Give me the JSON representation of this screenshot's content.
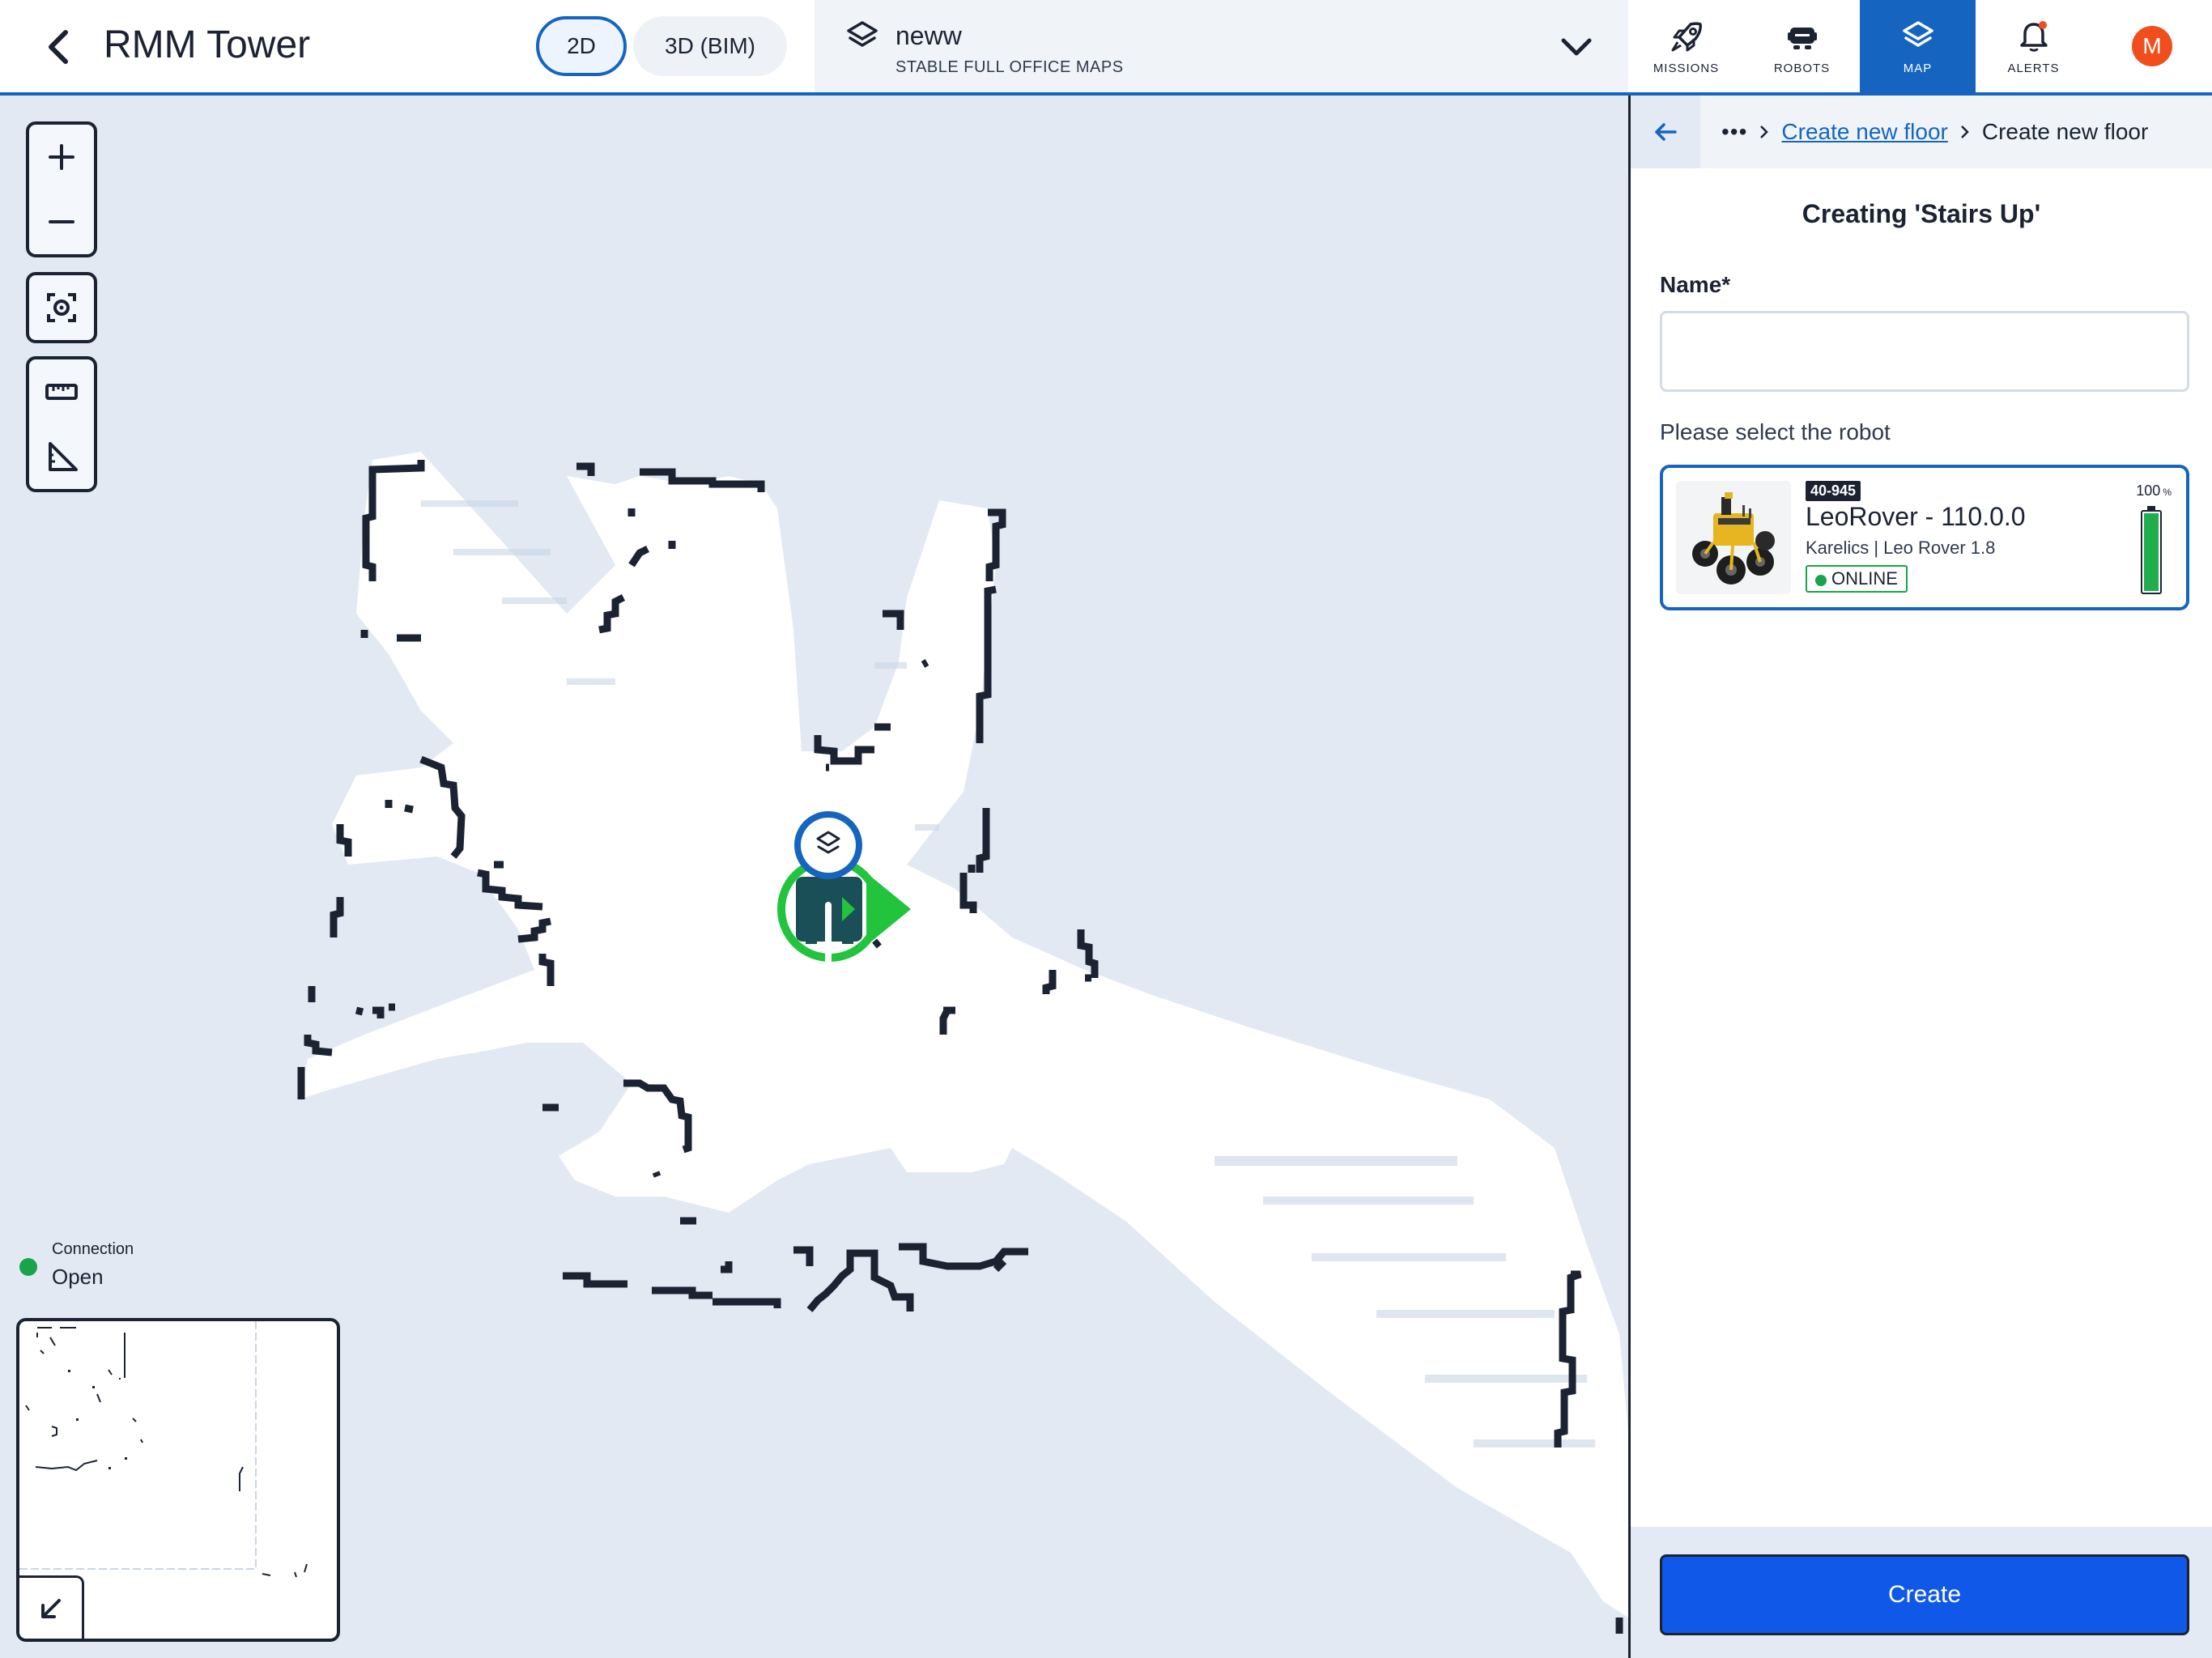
{
  "header": {
    "title": "RMM Tower",
    "view_2d": "2D",
    "view_3d": "3D (BIM)",
    "map_name": "neww",
    "map_subtitle": "STABLE FULL OFFICE MAPS"
  },
  "nav": [
    {
      "label": "MISSIONS",
      "icon": "rocket-icon"
    },
    {
      "label": "ROBOTS",
      "icon": "robot-icon"
    },
    {
      "label": "MAP",
      "icon": "layers-icon",
      "active": true
    },
    {
      "label": "ALERTS",
      "icon": "bell-icon",
      "badge": true
    }
  ],
  "user": {
    "initial": "M"
  },
  "connection": {
    "label": "Connection",
    "value": "Open"
  },
  "panel": {
    "breadcrumb_more": "•••",
    "breadcrumb_link": "Create new floor",
    "breadcrumb_current": "Create new floor",
    "title": "Creating 'Stairs Up'",
    "name_label": "Name*",
    "name_value": "",
    "robot_prompt": "Please select the robot",
    "robot": {
      "id": "40-945",
      "name": "LeoRover - 110.0.0",
      "subtitle": "Karelics | Leo Rover 1.8",
      "status": "ONLINE",
      "battery_value": "100",
      "battery_unit": "%",
      "battery_level": 1.0
    },
    "create_label": "Create"
  },
  "colors": {
    "accent": "#1565c0",
    "create_button": "#1059e8",
    "online": "#19a34a",
    "robot_marker": "#22c33d",
    "avatar": "#f04e1d",
    "map_background": "#e2e9f2",
    "map_wall": "#1b2333"
  }
}
